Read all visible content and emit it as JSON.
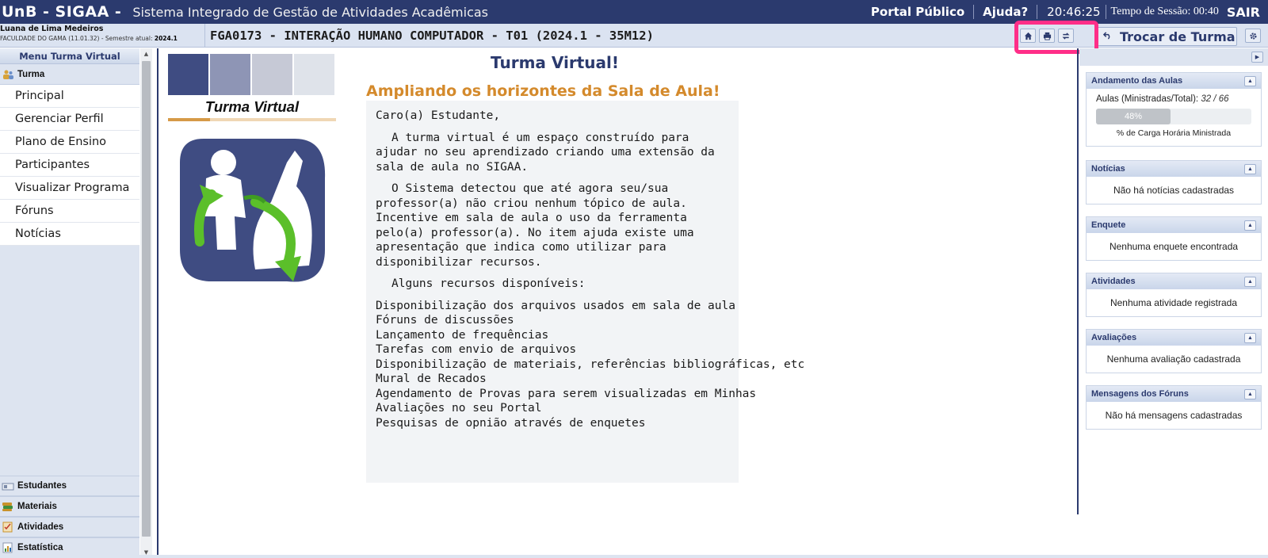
{
  "header": {
    "brand": "UnB - SIGAA -",
    "system_name": "Sistema Integrado de Gestão de Atividades Acadêmicas",
    "portal_link": "Portal Público",
    "help_link": "Ajuda?",
    "clock": "20:46:25",
    "session_label": "Tempo de Sessão: 00:40",
    "logout": "SAIR"
  },
  "user": {
    "name": "Luana de Lima Medeiros",
    "detail_prefix": "FACULDADE DO GAMA (11.01.32) - Semestre atual:",
    "semester": "2024.1"
  },
  "course": {
    "title": "FGA0173 - INTERAÇÃO HUMANO COMPUTADOR - T01 (2024.1 - 35M12)",
    "switch_label": "Trocar de Turma"
  },
  "menu": {
    "header": "Menu Turma Virtual",
    "section": "Turma",
    "items": [
      "Principal",
      "Gerenciar Perfil",
      "Plano de Ensino",
      "Participantes",
      "Visualizar Programa",
      "Fóruns",
      "Notícias"
    ],
    "bottom_sections": [
      "Estudantes",
      "Materiais",
      "Atividades",
      "Estatística"
    ]
  },
  "logo": {
    "label": "Turma Virtual",
    "swatch_colors": [
      "#3f4c82",
      "#8e95b5",
      "#c6c9d6",
      "#dfe3ea"
    ]
  },
  "main": {
    "title": "Turma Virtual!",
    "subtitle": "Ampliando os horizontes da Sala de Aula!",
    "greeting": "Caro(a) Estudante,",
    "p1": "A turma virtual é um espaço construído para ajudar no seu aprendizado criando uma extensão da sala de aula no SIGAA.",
    "p2": "O Sistema detectou que até agora seu/sua professor(a) não criou nenhum tópico de aula. Incentive em sala de aula o uso da ferramenta pelo(a) professor(a). No item ajuda existe uma apresentação que indica como utilizar para disponibilizar recursos.",
    "p3": "Alguns recursos disponíveis:",
    "resources": [
      "Disponibilização dos arquivos usados em sala de aula",
      "Fóruns de discussões",
      "Lançamento de frequências",
      "Tarefas com envio de arquivos",
      "Disponibilização de materiais, referências bibliográficas, etc",
      "Mural de Recados",
      "Agendamento de Provas para serem visualizadas em Minhas",
      "Avaliações no seu Portal",
      "Pesquisas de opnião através de enquetes"
    ]
  },
  "sidebar": {
    "andamento": {
      "title": "Andamento das Aulas",
      "aulas_label": "Aulas (Ministradas/Total):",
      "aulas_value": "32 / 66",
      "progress_text": "48%",
      "progress_fraction": 0.48,
      "carga_label": "% de Carga Horária Ministrada"
    },
    "widgets": [
      {
        "title": "Notícias",
        "body": "Não há notícias cadastradas"
      },
      {
        "title": "Enquete",
        "body": "Nenhuma enquete encontrada"
      },
      {
        "title": "Atividades",
        "body": "Nenhuma atividade registrada"
      },
      {
        "title": "Avaliações",
        "body": "Nenhuma avaliação cadastrada"
      },
      {
        "title": "Mensagens dos Fóruns",
        "body": "Não há mensagens cadastradas"
      }
    ]
  },
  "colors": {
    "header_bg": "#2b3a6e",
    "accent_orange": "#d48a2c",
    "highlight": "#ff2e88",
    "arrow_green": "#5bbf2a"
  },
  "icons": {
    "home": "home-icon",
    "print": "print-icon",
    "swap": "swap-arrows-icon",
    "trocar": "undo-arrow-icon",
    "gear": "gear-icon"
  }
}
